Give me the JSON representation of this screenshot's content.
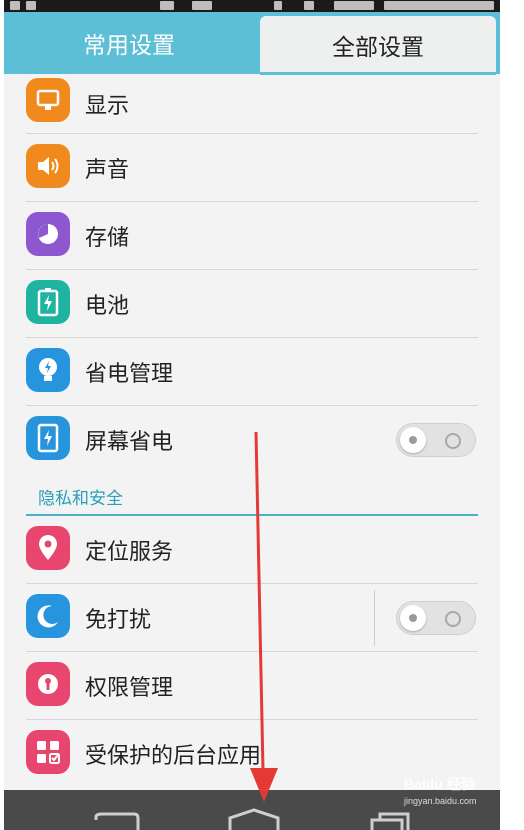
{
  "tabs": [
    {
      "label": "常用设置",
      "selected": false
    },
    {
      "label": "全部设置",
      "selected": true
    }
  ],
  "rows_top": [
    {
      "label": "显示",
      "icon": "display-icon",
      "color": "#f08a1c"
    },
    {
      "label": "声音",
      "icon": "speaker-icon",
      "color": "#f08a1c"
    },
    {
      "label": "存储",
      "icon": "storage-pie-icon",
      "color": "#8c57cf"
    },
    {
      "label": "电池",
      "icon": "battery-icon",
      "color": "#1fb3a1"
    },
    {
      "label": "省电管理",
      "icon": "lightbulb-icon",
      "color": "#2795dd"
    },
    {
      "label": "屏幕省电",
      "icon": "screen-power-icon",
      "color": "#2795dd",
      "toggle": "off"
    }
  ],
  "section": {
    "label": "隐私和安全",
    "color": "#2a9fba"
  },
  "rows_bottom": [
    {
      "label": "定位服务",
      "icon": "location-pin-icon",
      "color": "#e8466e"
    },
    {
      "label": "免打扰",
      "icon": "moon-icon",
      "color": "#2795dd",
      "toggle": "off"
    },
    {
      "label": "权限管理",
      "icon": "keyhole-icon",
      "color": "#e8466e"
    },
    {
      "label": "受保护的后台应用",
      "icon": "protected-apps-icon",
      "color": "#e8466e"
    }
  ],
  "watermark": {
    "text": "Baidu 经验",
    "url_text": "jingyan.baidu.com"
  }
}
